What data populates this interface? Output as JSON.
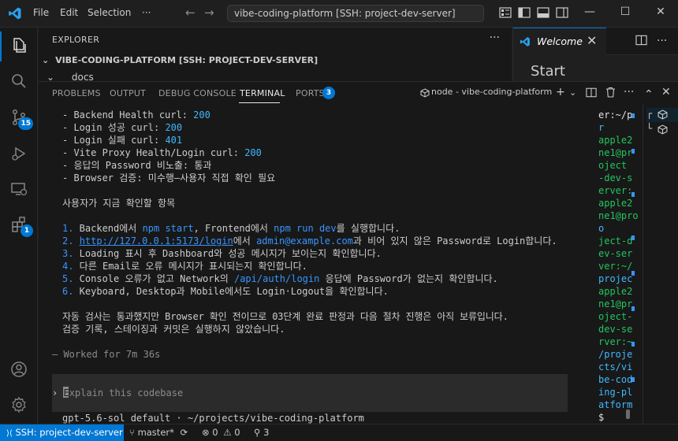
{
  "titlebar": {
    "menu": [
      "File",
      "Edit",
      "Selection"
    ],
    "more": "···",
    "back": "←",
    "forward": "→",
    "search_text": "vibe-coding-platform [SSH: project-dev-server]",
    "minimize": "—",
    "maximize": "☐",
    "close": "✕"
  },
  "activity": {
    "source_control_badge": "15",
    "extensions_badge": "1"
  },
  "explorer": {
    "title": "EXPLORER",
    "more": "···",
    "root_chevron": "⌄",
    "root_label": "VIBE-CODING-PLATFORM [SSH: PROJECT-DEV-SERVER]",
    "docs_chevron": "⌄",
    "docs_label": "docs"
  },
  "editor": {
    "tab_label": "Welcome",
    "tab_close": "✕",
    "start_heading": "Start"
  },
  "panel": {
    "tabs": [
      "PROBLEMS",
      "OUTPUT",
      "DEBUG CONSOLE",
      "TERMINAL",
      "PORTS"
    ],
    "ports_badge": "3",
    "terminal_name": "node - vibe-coding-platform",
    "add": "+",
    "add_chevron": "⌄",
    "more": "···",
    "chevron_up": "⌃",
    "close": "✕"
  },
  "terminal": {
    "checks": [
      {
        "label": "- Backend Health curl: ",
        "value": "200"
      },
      {
        "label": "- Login 성공 curl: ",
        "value": "200"
      },
      {
        "label": "- Login 실패 curl: ",
        "value": "401"
      },
      {
        "label": "- Vite Proxy Health/Login curl: ",
        "value": "200"
      }
    ],
    "check_password": "- 응답의 Password 비노출: 통과",
    "check_browser": "- Browser 검증: 미수행—사용자 직접 확인 필요",
    "section_title": "사용자가 지금 확인할 항목",
    "steps": {
      "s1": {
        "num": "1.",
        "a": " Backend에서 ",
        "cmd1": "npm start",
        "b": ", Frontend에서 ",
        "cmd2": "npm run dev",
        "c": "를 실행합니다."
      },
      "s2": {
        "num": "2.",
        "url": "http://127.0.0.1:5173/login",
        "a": "에서 ",
        "email": "admin@example.com",
        "b": "과 비어 있지 않은 Password로 Login합니다."
      },
      "s3": {
        "num": "3.",
        "text": " Loading 표시 후 Dashboard와 성공 메시지가 보이는지 확인합니다."
      },
      "s4": {
        "num": "4.",
        "text": " 다른 Email로 오류 메시지가 표시되는지 확인합니다."
      },
      "s5": {
        "num": "5.",
        "a": " Console 오류가 없고 Network의 ",
        "path": "/api/auth/login",
        "b": " 응답에 Password가 없는지 확인합니다."
      },
      "s6": {
        "num": "6.",
        "text": " Keyboard, Desktop과 Mobile에서도 Login·Logout을 확인합니다."
      }
    },
    "summary_line1": "자동 검사는 통과했지만 Browser 확인 전이므로 03단계 완료 판정과 다음 절차 진행은 아직 보류입니다.",
    "summary_line2": "검증 기록, 스테이징과 커밋은 실행하지 않았습니다.",
    "worked_for": "— Worked for 7m 36s",
    "prompt_arrow": "›",
    "input_first_letter": "E",
    "input_placeholder": "xplain this codebase",
    "model_line": "gpt-5.6-sol default · ~/projects/vibe-coding-platform"
  },
  "terminal2": {
    "lines": [
      {
        "t": "er:~/p",
        "c": "w"
      },
      {
        "t": "r",
        "c": "b"
      },
      {
        "t": "apple2",
        "c": "g"
      },
      {
        "t": "ne1@pr",
        "c": "g"
      },
      {
        "t": "oject",
        "c": "g"
      },
      {
        "t": "-dev-s",
        "c": "g"
      },
      {
        "t": "erver:",
        "c": "g"
      },
      {
        "t": "apple2",
        "c": "g"
      },
      {
        "t": "ne1@pro",
        "c": "g"
      },
      {
        "t": "o",
        "c": "b"
      },
      {
        "t": "ject-d",
        "c": "g"
      },
      {
        "t": "ev-ser",
        "c": "g"
      },
      {
        "t": "ver:~/",
        "c": "g"
      },
      {
        "t": "projec",
        "c": "b"
      },
      {
        "t": "apple2",
        "c": "g"
      },
      {
        "t": "ne1@pr",
        "c": "g"
      },
      {
        "t": "oject-",
        "c": "g"
      },
      {
        "t": "dev-se",
        "c": "g"
      },
      {
        "t": "rver:~",
        "c": "g"
      },
      {
        "t": "/proje",
        "c": "b"
      },
      {
        "t": "cts/vi",
        "c": "b"
      },
      {
        "t": "be-cod",
        "c": "b"
      },
      {
        "t": "ing-pl",
        "c": "b"
      },
      {
        "t": "atform",
        "c": "b"
      },
      {
        "t": "$ ",
        "c": "w"
      }
    ]
  },
  "terminal_list": {
    "items": [
      {
        "prefix": "┌"
      },
      {
        "prefix": "└"
      }
    ]
  },
  "status": {
    "remote": "SSH: project-dev-server",
    "branch": "master*",
    "errors": "0",
    "warnings": "0",
    "ports": "3"
  }
}
